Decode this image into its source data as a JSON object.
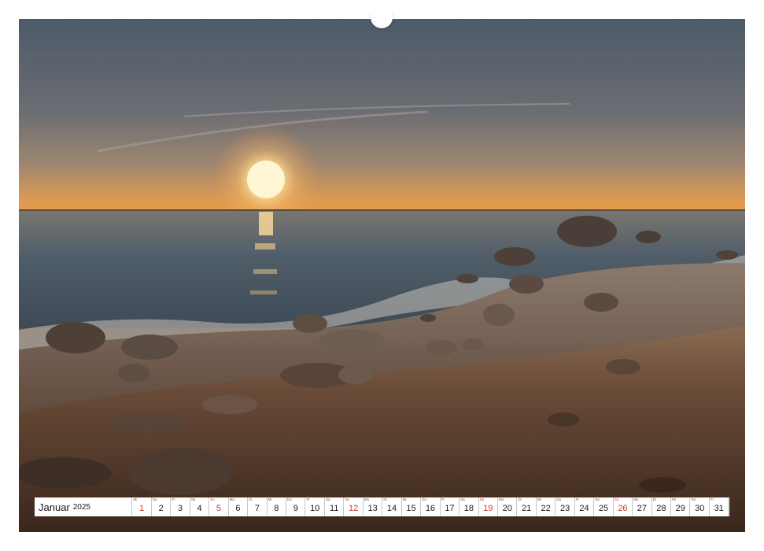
{
  "calendar": {
    "month": "Januar",
    "year": "2025",
    "days": [
      {
        "n": "1",
        "wd": "Mi",
        "holiday": true
      },
      {
        "n": "2",
        "wd": "Do"
      },
      {
        "n": "3",
        "wd": "Fr"
      },
      {
        "n": "4",
        "wd": "Sa"
      },
      {
        "n": "5",
        "wd": "So",
        "holiday": true
      },
      {
        "n": "6",
        "wd": "Mo"
      },
      {
        "n": "7",
        "wd": "Di"
      },
      {
        "n": "8",
        "wd": "Mi"
      },
      {
        "n": "9",
        "wd": "Do"
      },
      {
        "n": "10",
        "wd": "Fr"
      },
      {
        "n": "11",
        "wd": "Sa"
      },
      {
        "n": "12",
        "wd": "So",
        "holiday": true
      },
      {
        "n": "13",
        "wd": "Mo"
      },
      {
        "n": "14",
        "wd": "Di"
      },
      {
        "n": "15",
        "wd": "Mi"
      },
      {
        "n": "16",
        "wd": "Do"
      },
      {
        "n": "17",
        "wd": "Fr"
      },
      {
        "n": "18",
        "wd": "Sa"
      },
      {
        "n": "19",
        "wd": "So",
        "holiday": true
      },
      {
        "n": "20",
        "wd": "Mo"
      },
      {
        "n": "21",
        "wd": "Di"
      },
      {
        "n": "22",
        "wd": "Mi"
      },
      {
        "n": "23",
        "wd": "Do"
      },
      {
        "n": "24",
        "wd": "Fr"
      },
      {
        "n": "25",
        "wd": "Sa"
      },
      {
        "n": "26",
        "wd": "So",
        "holiday": true
      },
      {
        "n": "27",
        "wd": "Mo"
      },
      {
        "n": "28",
        "wd": "Di"
      },
      {
        "n": "29",
        "wd": "Mi"
      },
      {
        "n": "30",
        "wd": "Do"
      },
      {
        "n": "31",
        "wd": "Fr"
      }
    ]
  },
  "colors": {
    "holiday": "#c0392b",
    "sun": "#fff4cf",
    "horizon": "#e9954a",
    "sea": "#4a5a68",
    "sand": "#5a3f2e"
  }
}
